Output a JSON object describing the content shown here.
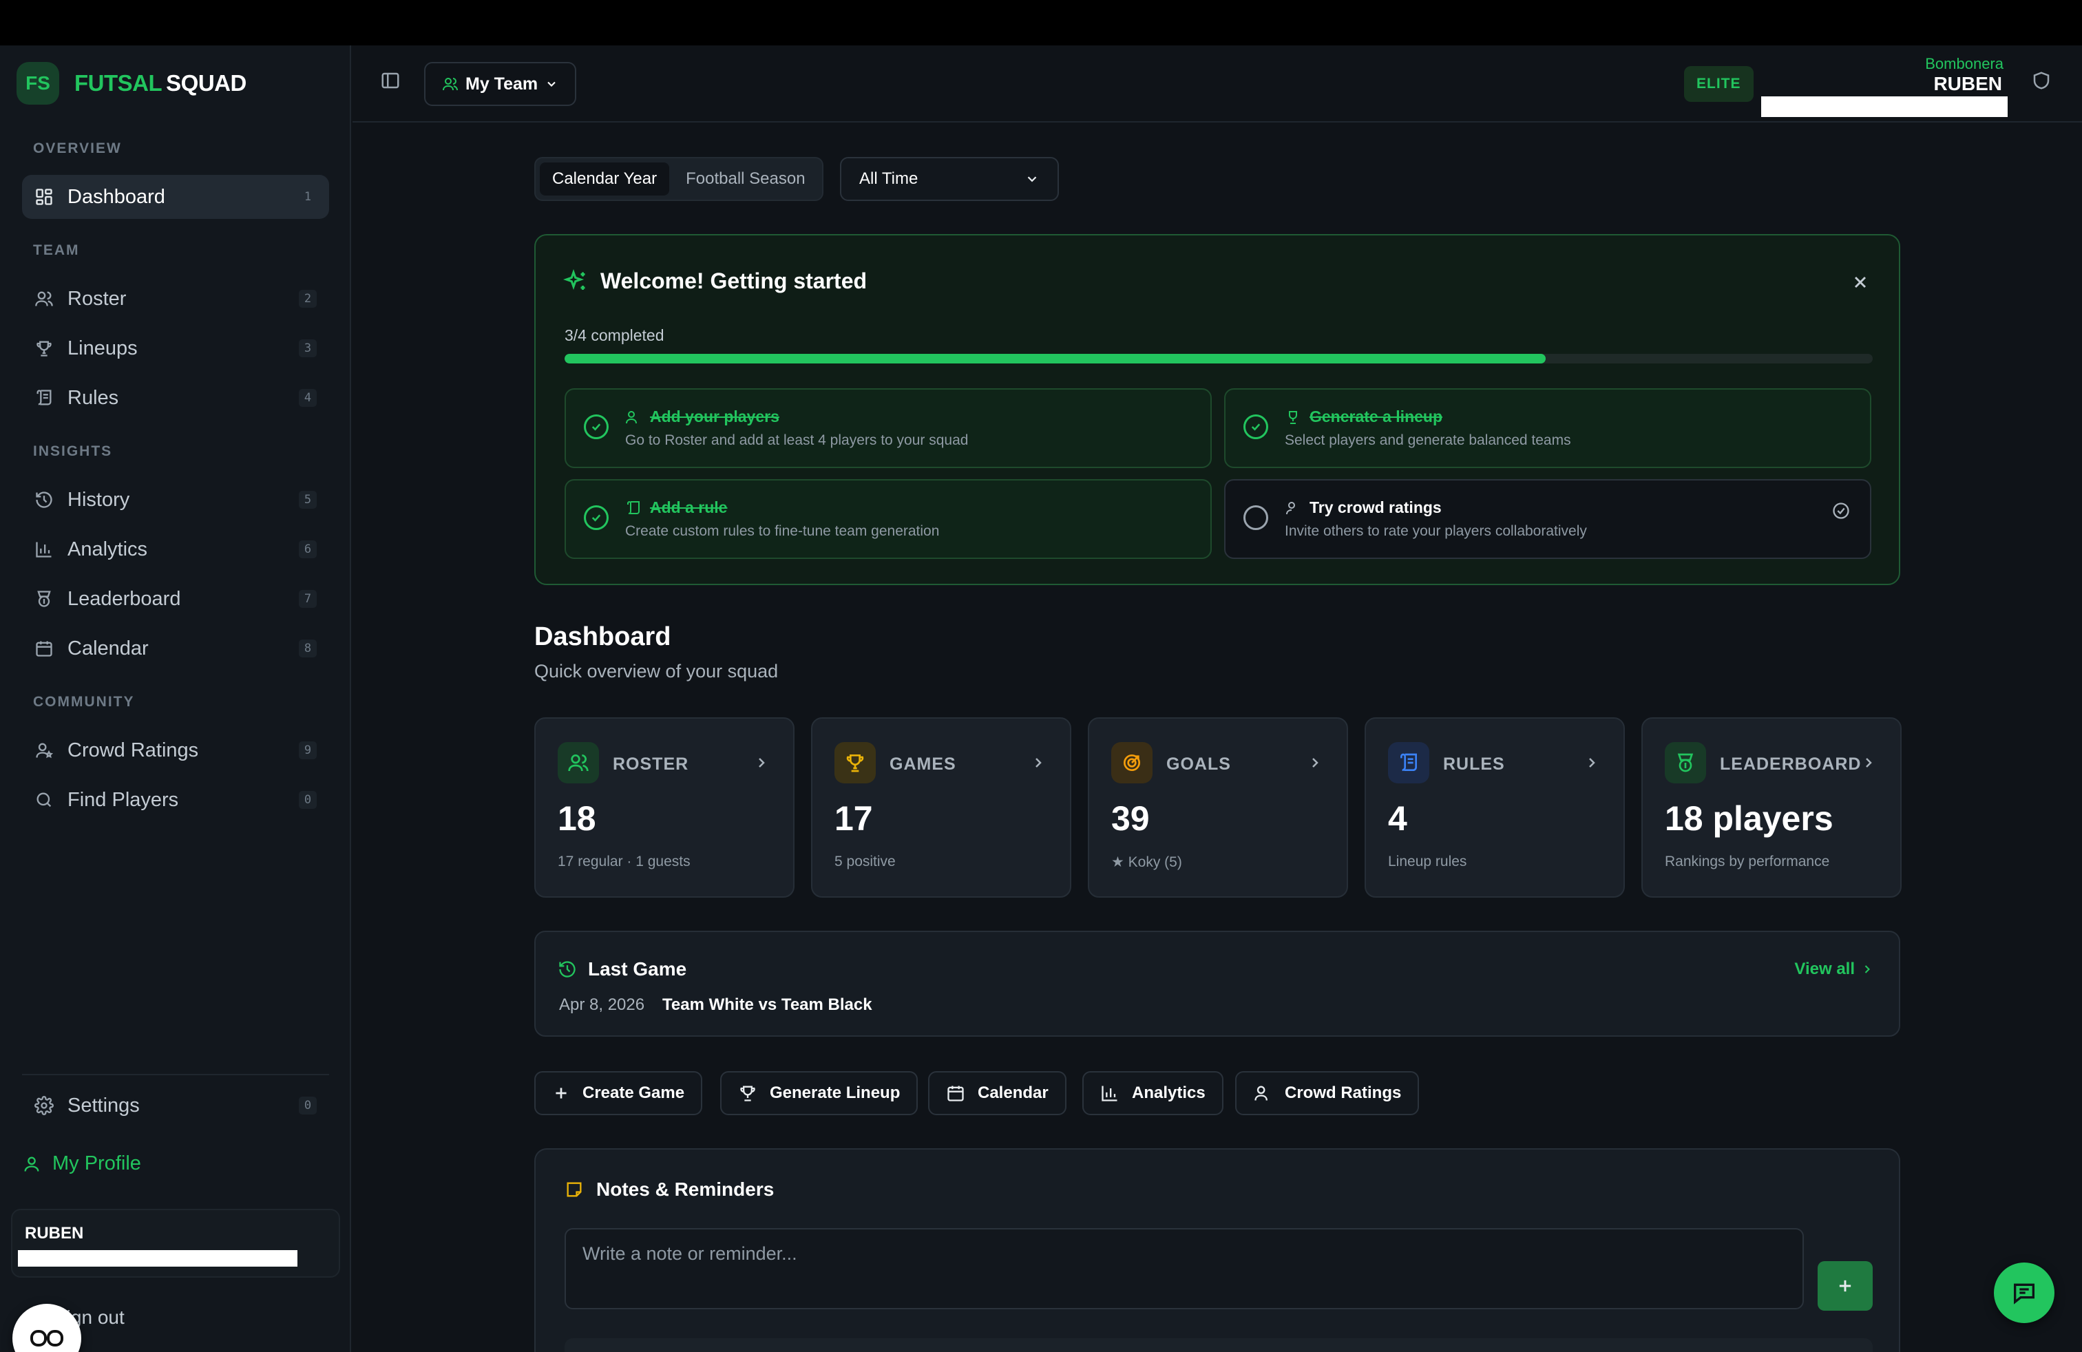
{
  "app": {
    "brand_short": "FS",
    "brand_name_1": "FUTSAL",
    "brand_name_2": "SQUAD",
    "accent": "#22c55e"
  },
  "sidebar": {
    "sections": {
      "overview": "OVERVIEW",
      "team": "TEAM",
      "insights": "INSIGHTS",
      "community": "COMMUNITY"
    },
    "items": [
      {
        "label": "Dashboard",
        "shortcut": "1",
        "icon": "dashboard-icon",
        "active": true
      },
      {
        "label": "Roster",
        "shortcut": "2",
        "icon": "users-icon"
      },
      {
        "label": "Lineups",
        "shortcut": "3",
        "icon": "trophy-icon"
      },
      {
        "label": "Rules",
        "shortcut": "4",
        "icon": "scroll-icon"
      },
      {
        "label": "History",
        "shortcut": "5",
        "icon": "history-icon"
      },
      {
        "label": "Analytics",
        "shortcut": "6",
        "icon": "bar-chart-icon"
      },
      {
        "label": "Leaderboard",
        "shortcut": "7",
        "icon": "medal-icon"
      },
      {
        "label": "Calendar",
        "shortcut": "8",
        "icon": "calendar-icon"
      },
      {
        "label": "Crowd Ratings",
        "shortcut": "9",
        "icon": "user-star-icon"
      },
      {
        "label": "Find Players",
        "shortcut": "0",
        "icon": "search-icon"
      }
    ],
    "settings": {
      "label": "Settings",
      "shortcut": "0"
    },
    "profile_label": "My Profile",
    "user_name": "RUBEN",
    "signout_label": "Sign out"
  },
  "header": {
    "team_selector": "My Team",
    "plan_badge": "ELITE",
    "team_name": "Bombonera",
    "user_name": "RUBEN"
  },
  "filters": {
    "period_tabs": [
      "Calendar Year",
      "Football Season"
    ],
    "selected_tab": "Calendar Year",
    "range": "All Time"
  },
  "welcome": {
    "title": "Welcome! Getting started",
    "progress_label": "3/4 completed",
    "progress": 0.75,
    "tasks": [
      {
        "title": "Add your players",
        "desc": "Go to Roster and add at least 4 players to your squad",
        "done": true
      },
      {
        "title": "Generate a lineup",
        "desc": "Select players and generate balanced teams",
        "done": true
      },
      {
        "title": "Add a rule",
        "desc": "Create custom rules to fine-tune team generation",
        "done": true
      },
      {
        "title": "Try crowd ratings",
        "desc": "Invite others to rate your players collaboratively",
        "done": false
      }
    ]
  },
  "dashboard": {
    "title": "Dashboard",
    "subtitle": "Quick overview of your squad",
    "cards": [
      {
        "label": "ROSTER",
        "value": "18",
        "foot": "17 regular · 1 guests",
        "color": "#22c55e"
      },
      {
        "label": "GAMES",
        "value": "17",
        "foot": "5 positive",
        "color": "#eab308"
      },
      {
        "label": "GOALS",
        "value": "39",
        "foot": "★ Koky (5)",
        "color": "#f59e0b"
      },
      {
        "label": "RULES",
        "value": "4",
        "foot": "Lineup rules",
        "color": "#3b82f6"
      },
      {
        "label": "LEADERBOARD",
        "value": "18 players",
        "foot": "Rankings by performance",
        "color": "#22c55e"
      }
    ]
  },
  "last_game": {
    "title": "Last Game",
    "view_all": "View all",
    "date": "Apr 8, 2026",
    "match": "Team White vs Team Black"
  },
  "quick_actions": [
    "Create Game",
    "Generate Lineup",
    "Calendar",
    "Analytics",
    "Crowd Ratings"
  ],
  "notes": {
    "title": "Notes & Reminders",
    "placeholder": "Write a note or reminder..."
  }
}
